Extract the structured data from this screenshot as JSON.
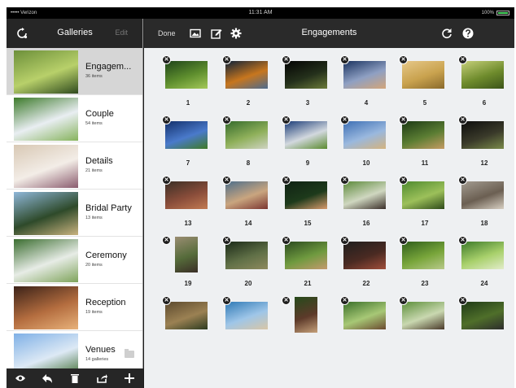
{
  "status": {
    "carrier": "••••• Verizon",
    "time": "11:31 AM",
    "battery": "100%"
  },
  "sidebar": {
    "title": "Galleries",
    "edit_label": "Edit",
    "items": [
      {
        "name": "Engagem...",
        "count": "36 items",
        "selected": true,
        "colors": [
          "#6c8f3a",
          "#b8d06a",
          "#2f4a1e"
        ]
      },
      {
        "name": "Couple",
        "count": "54 items",
        "selected": false,
        "colors": [
          "#3c7a2a",
          "#e9eef2",
          "#86b35c"
        ]
      },
      {
        "name": "Details",
        "count": "21 items",
        "selected": false,
        "colors": [
          "#d8c8b4",
          "#f3ede7",
          "#8a5b6e"
        ]
      },
      {
        "name": "Bridal Party",
        "count": "13 items",
        "selected": false,
        "colors": [
          "#8fb7d9",
          "#2e4a2a",
          "#c9b37f"
        ]
      },
      {
        "name": "Ceremony",
        "count": "20 items",
        "selected": false,
        "colors": [
          "#3a6d2f",
          "#e7ece6",
          "#7ea35a"
        ]
      },
      {
        "name": "Reception",
        "count": "19 items",
        "selected": false,
        "colors": [
          "#3b2218",
          "#b46d3f",
          "#e8b27a"
        ]
      },
      {
        "name": "Venues",
        "count": "14 galleries",
        "selected": false,
        "folder": true,
        "colors": [
          "#7fb0e6",
          "#dde9f5",
          "#3d6b2f"
        ]
      }
    ]
  },
  "main": {
    "title": "Engagements",
    "done_label": "Done",
    "photos": [
      {
        "num": "1",
        "c": [
          "#1e4419",
          "#5f8f2e",
          "#a4c95a"
        ]
      },
      {
        "num": "2",
        "c": [
          "#0f2238",
          "#c7761e",
          "#4d6b8e"
        ]
      },
      {
        "num": "3",
        "c": [
          "#040404",
          "#24301b",
          "#6b7b3a"
        ]
      },
      {
        "num": "4",
        "c": [
          "#1a3360",
          "#8fa0c3",
          "#d3a57a"
        ]
      },
      {
        "num": "5",
        "c": [
          "#e6c889",
          "#c9a24e",
          "#8a6a2c"
        ]
      },
      {
        "num": "6",
        "c": [
          "#c6d07a",
          "#6e8b2c",
          "#3b5419"
        ]
      },
      {
        "num": "7",
        "c": [
          "#13306b",
          "#4a7acb",
          "#3f7a25"
        ]
      },
      {
        "num": "8",
        "c": [
          "#356b2c",
          "#8fb05a",
          "#cfd3c2"
        ]
      },
      {
        "num": "9",
        "c": [
          "#1b3c78",
          "#d2d8de",
          "#5a8a2e"
        ]
      },
      {
        "num": "10",
        "c": [
          "#3d6fb4",
          "#9ab8de",
          "#d4b37e"
        ]
      },
      {
        "num": "11",
        "c": [
          "#1c3a15",
          "#5b7d33",
          "#c59b63"
        ]
      },
      {
        "num": "12",
        "c": [
          "#0d0d0d",
          "#3a3a2a",
          "#7a8a4a"
        ]
      },
      {
        "num": "13",
        "c": [
          "#3b2f26",
          "#8a4d3a",
          "#c27a52"
        ]
      },
      {
        "num": "14",
        "c": [
          "#4e6f8b",
          "#c9a57f",
          "#7b3530"
        ]
      },
      {
        "num": "15",
        "c": [
          "#102214",
          "#1d3a1b",
          "#d79a6c"
        ]
      },
      {
        "num": "16",
        "c": [
          "#5c8a3a",
          "#cfd7c0",
          "#3a2e29"
        ]
      },
      {
        "num": "17",
        "c": [
          "#4f8a2f",
          "#9cc05a",
          "#2e4a1a"
        ]
      },
      {
        "num": "18",
        "c": [
          "#a39c91",
          "#6b5f52",
          "#d7cfc2"
        ]
      },
      {
        "num": "19",
        "c": [
          "#9a8d72",
          "#556b3a",
          "#3a2e26"
        ],
        "portrait": true
      },
      {
        "num": "20",
        "c": [
          "#1b2a18",
          "#5f6f46",
          "#8e8a5e"
        ]
      },
      {
        "num": "21",
        "c": [
          "#2b4a1f",
          "#6f9a3f",
          "#c49a6d"
        ]
      },
      {
        "num": "22",
        "c": [
          "#1f1f1f",
          "#4a2a22",
          "#a04e3a"
        ]
      },
      {
        "num": "23",
        "c": [
          "#2f5e1c",
          "#78a53a",
          "#b8c98a"
        ]
      },
      {
        "num": "24",
        "c": [
          "#3d7a2a",
          "#a8d06b",
          "#e2ecc9"
        ]
      },
      {
        "num": "",
        "c": [
          "#5d4a2e",
          "#9b8153",
          "#2c3b20"
        ]
      },
      {
        "num": "",
        "c": [
          "#2f7ab6",
          "#9fc6e8",
          "#d9c6a6"
        ]
      },
      {
        "num": "",
        "c": [
          "#264a1b",
          "#5d3a2a",
          "#c5a07a"
        ],
        "portrait": true
      },
      {
        "num": "",
        "c": [
          "#3a6f2a",
          "#a7c876",
          "#6b4a30"
        ]
      },
      {
        "num": "",
        "c": [
          "#5c8f3a",
          "#c9d8b0",
          "#4a3a2a"
        ]
      },
      {
        "num": "",
        "c": [
          "#1f3a17",
          "#4f6f2a",
          "#2d2d2d"
        ]
      }
    ]
  }
}
